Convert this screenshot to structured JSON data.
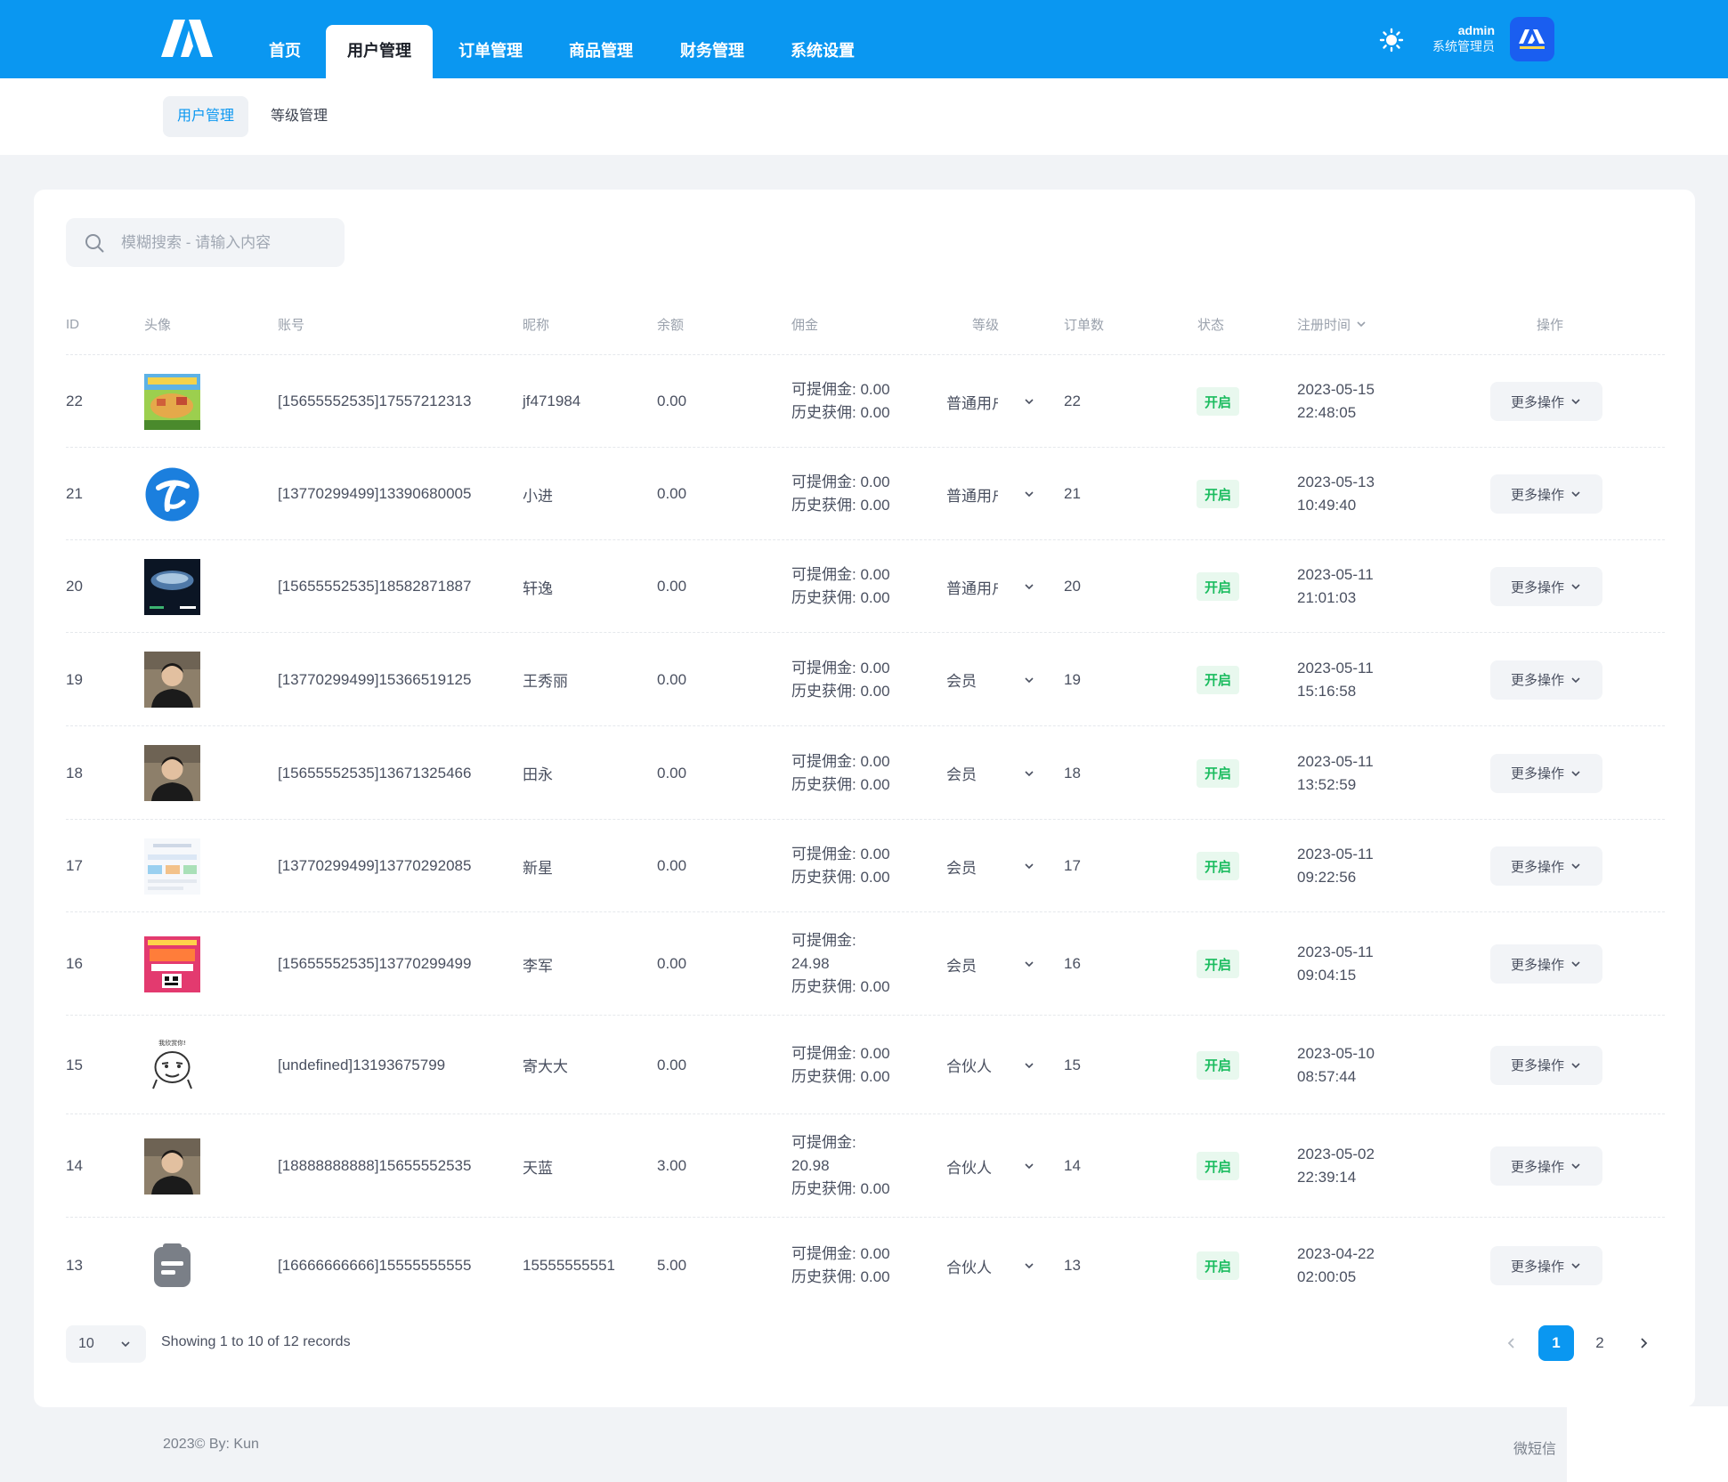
{
  "nav": [
    "首页",
    "用户管理",
    "订单管理",
    "商品管理",
    "财务管理",
    "系统设置"
  ],
  "nav_active": 1,
  "user": {
    "name": "admin",
    "role": "系统管理员",
    "avatar_text": "ЛЛ"
  },
  "subnav": [
    "用户管理",
    "等级管理"
  ],
  "search_placeholder": "模糊搜索 - 请输入内容",
  "table": {
    "headers": [
      "ID",
      "头像",
      "账号",
      "昵称",
      "余额",
      "佣金",
      "等级",
      "订单数",
      "状态",
      "注册时间",
      "操作"
    ],
    "commission_withdrawable_label": "可提佣金:",
    "commission_history_label": "历史获佣:",
    "more_label": "更多操作",
    "rows": [
      {
        "id": "22",
        "account": "[15655552535]17557212313",
        "nickname": "jf471984",
        "balance": "0.00",
        "withdrawable": "0.00",
        "history": "0.00",
        "level": "普通用户",
        "orders": "22",
        "status": "开启",
        "date": "2023-05-15",
        "time": "22:48:05",
        "avatar_icon": "game-screenshot"
      },
      {
        "id": "21",
        "account": "[13770299499]13390680005",
        "nickname": "小进",
        "balance": "0.00",
        "withdrawable": "0.00",
        "history": "0.00",
        "level": "普通用户",
        "orders": "21",
        "status": "开启",
        "date": "2023-05-13",
        "time": "10:49:40",
        "avatar_icon": "telecom-logo"
      },
      {
        "id": "20",
        "account": "[15655552535]18582871887",
        "nickname": "轩逸",
        "balance": "0.00",
        "withdrawable": "0.00",
        "history": "0.00",
        "level": "普通用户",
        "orders": "20",
        "status": "开启",
        "date": "2023-05-11",
        "time": "21:01:03",
        "avatar_icon": "earth-photo"
      },
      {
        "id": "19",
        "account": "[13770299499]15366519125",
        "nickname": "王秀丽",
        "balance": "0.00",
        "withdrawable": "0.00",
        "history": "0.00",
        "level": "会员",
        "orders": "19",
        "status": "开启",
        "date": "2023-05-11",
        "time": "15:16:58",
        "avatar_icon": "person-photo"
      },
      {
        "id": "18",
        "account": "[15655552535]13671325466",
        "nickname": "田永",
        "balance": "0.00",
        "withdrawable": "0.00",
        "history": "0.00",
        "level": "会员",
        "orders": "18",
        "status": "开启",
        "date": "2023-05-11",
        "time": "13:52:59",
        "avatar_icon": "person-photo"
      },
      {
        "id": "17",
        "account": "[13770299499]13770292085",
        "nickname": "新星",
        "balance": "0.00",
        "withdrawable": "0.00",
        "history": "0.00",
        "level": "会员",
        "orders": "17",
        "status": "开启",
        "date": "2023-05-11",
        "time": "09:22:56",
        "avatar_icon": "app-screenshot"
      },
      {
        "id": "16",
        "account": "[15655552535]13770299499",
        "nickname": "李军",
        "balance": "0.00",
        "withdrawable": "24.98",
        "history": "0.00",
        "level": "会员",
        "orders": "16",
        "status": "开启",
        "date": "2023-05-11",
        "time": "09:04:15",
        "avatar_icon": "poster-qrcode"
      },
      {
        "id": "15",
        "account": "[undefined]13193675799",
        "nickname": "寄大大",
        "balance": "0.00",
        "withdrawable": "0.00",
        "history": "0.00",
        "level": "合伙人",
        "orders": "15",
        "status": "开启",
        "date": "2023-05-10",
        "time": "08:57:44",
        "avatar_icon": "meme-face",
        "avatar_caption": "我欣赏你!"
      },
      {
        "id": "14",
        "account": "[18888888888]15655552535",
        "nickname": "天蓝",
        "balance": "3.00",
        "withdrawable": "20.98",
        "history": "0.00",
        "level": "合伙人",
        "orders": "14",
        "status": "开启",
        "date": "2023-05-02",
        "time": "22:39:14",
        "avatar_icon": "person-photo"
      },
      {
        "id": "13",
        "account": "[16666666666]15555555555",
        "nickname": "15555555551",
        "balance": "5.00",
        "withdrawable": "0.00",
        "history": "0.00",
        "level": "合伙人",
        "orders": "13",
        "status": "开启",
        "date": "2023-04-22",
        "time": "02:00:05",
        "avatar_icon": "default-avatar-icon"
      }
    ]
  },
  "pagination": {
    "page_size": "10",
    "summary": "Showing 1 to 10 of 12 records",
    "pages": [
      "1",
      "2"
    ],
    "current": "1"
  },
  "footer": {
    "left": "2023© By: Kun",
    "right": "微短信"
  },
  "colors": {
    "primary": "#0a97f1",
    "success": "#1bbc5f",
    "success_bg": "#e8f8ee",
    "background": "#f1f3f6"
  }
}
